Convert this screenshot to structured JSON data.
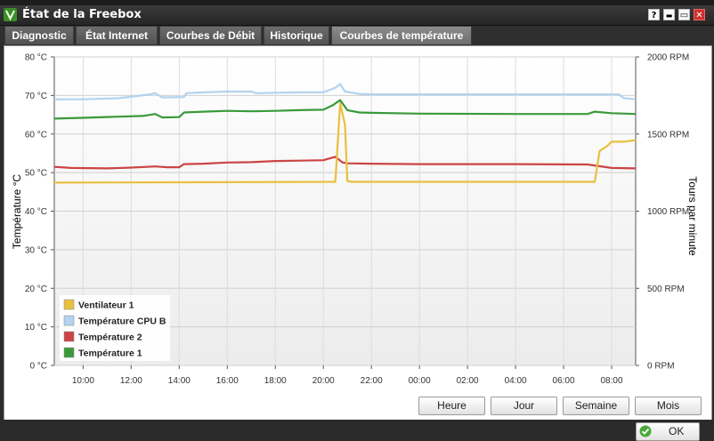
{
  "window": {
    "title": "État de la Freebox",
    "controls": {
      "help": "?",
      "minimize": "▬",
      "maximize": "▭",
      "close": "✕"
    }
  },
  "tabs": [
    {
      "label": "Diagnostic",
      "active": false
    },
    {
      "label": "État Internet",
      "active": false
    },
    {
      "label": "Courbes de Débit",
      "active": false
    },
    {
      "label": "Historique",
      "active": false
    },
    {
      "label": "Courbes de température",
      "active": true
    }
  ],
  "chart_data": {
    "type": "line",
    "xlabel": "",
    "ylabel": "Température °C",
    "y2label": "Tours par minute",
    "x_ticks": [
      "10:00",
      "12:00",
      "14:00",
      "16:00",
      "18:00",
      "20:00",
      "22:00",
      "00:00",
      "02:00",
      "04:00",
      "06:00",
      "08:00"
    ],
    "x_range_hours": [
      8.8,
      33.0
    ],
    "ylim": [
      0,
      80
    ],
    "y_ticks": [
      "0 °C",
      "10 °C",
      "20 °C",
      "30 °C",
      "40 °C",
      "50 °C",
      "60 °C",
      "70 °C",
      "80 °C"
    ],
    "y2lim": [
      0,
      2000
    ],
    "y2_ticks": [
      "0 RPM",
      "500 RPM",
      "1000 RPM",
      "1500 RPM",
      "2000 RPM"
    ],
    "grid": true,
    "legend_position": "bottom-left",
    "series": [
      {
        "name": "Ventilateur 1",
        "axis": "right",
        "color": "#e8c040",
        "x": [
          8.8,
          20.5,
          20.7,
          20.9,
          21.0,
          21.2,
          31.3,
          31.5,
          31.8,
          32.0,
          32.5,
          33.0
        ],
        "values": [
          1185,
          1190,
          1700,
          1560,
          1195,
          1190,
          1190,
          1390,
          1420,
          1450,
          1450,
          1460
        ]
      },
      {
        "name": "Température CPU B",
        "axis": "left",
        "color": "#b3d3ee",
        "x": [
          8.8,
          10.0,
          11.5,
          12.8,
          13.0,
          13.3,
          13.4,
          14.2,
          14.3,
          15.0,
          16.0,
          17.0,
          17.2,
          18.0,
          19.0,
          20.0,
          20.5,
          20.7,
          20.9,
          21.5,
          22.0,
          24.0,
          28.0,
          31.0,
          32.3,
          32.5,
          33.0
        ],
        "values": [
          69,
          69,
          69.3,
          70.3,
          70.6,
          69.5,
          69.5,
          69.6,
          70.6,
          70.8,
          71,
          71,
          70.6,
          70.7,
          70.8,
          70.8,
          72,
          73,
          71,
          70.4,
          70.3,
          70.3,
          70.3,
          70.3,
          70.3,
          69.3,
          69
        ]
      },
      {
        "name": "Température 2",
        "axis": "left",
        "color": "#cc4444",
        "x": [
          8.8,
          9.5,
          11.0,
          12.0,
          13.0,
          13.5,
          14.0,
          14.2,
          15.0,
          16.0,
          17.0,
          18.0,
          19.0,
          20.0,
          20.5,
          20.8,
          21.0,
          22.0,
          24.0,
          28.0,
          31.0,
          32.0,
          33.0
        ],
        "values": [
          51.5,
          51.2,
          51.1,
          51.3,
          51.6,
          51.4,
          51.4,
          52.2,
          52.3,
          52.6,
          52.7,
          53,
          53.1,
          53.2,
          54.1,
          52.6,
          52.4,
          52.3,
          52.2,
          52.2,
          52.1,
          51.2,
          51.1
        ]
      },
      {
        "name": "Température 1",
        "axis": "left",
        "color": "#3a9a3a",
        "x": [
          8.8,
          10.0,
          11.5,
          12.5,
          13.0,
          13.3,
          14.0,
          14.2,
          15.0,
          16.0,
          17.0,
          18.0,
          19.0,
          20.0,
          20.4,
          20.7,
          21.0,
          21.5,
          22.0,
          24.0,
          28.0,
          31.0,
          31.3,
          32.0,
          33.0
        ],
        "values": [
          64,
          64.2,
          64.5,
          64.7,
          65.2,
          64.3,
          64.4,
          65.6,
          65.8,
          66,
          65.9,
          66,
          66.2,
          66.3,
          67.5,
          68.8,
          66.2,
          65.6,
          65.5,
          65.3,
          65.2,
          65.2,
          65.8,
          65.4,
          65.2
        ]
      }
    ]
  },
  "buttons": {
    "heure": "Heure",
    "jour": "Jour",
    "semaine": "Semaine",
    "mois": "Mois",
    "ok": "OK"
  }
}
